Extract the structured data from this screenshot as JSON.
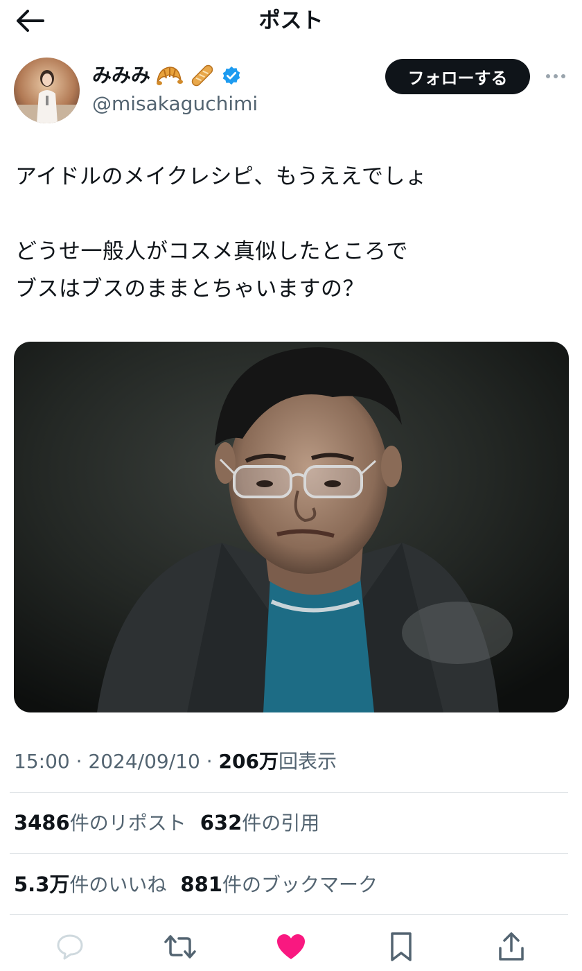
{
  "header": {
    "title": "ポスト",
    "back_icon": "arrow-left-icon"
  },
  "author": {
    "display_name": "みみみ",
    "name_emoji": [
      "croissant-icon",
      "baguette-icon"
    ],
    "verified_icon": "verified-badge-icon",
    "handle": "@misakaguchimi",
    "follow_label": "フォローする",
    "more_icon": "more-horizontal-icon"
  },
  "tweet": {
    "lines": [
      "アイドルのメイクレシピ、もうええでしょ",
      "どうせ一般人がコスメ真似したところで",
      "ブスはブスのままとちゃいますの？"
    ]
  },
  "meta": {
    "time": "15:00",
    "date": "2024/09/10",
    "views_number": "206万",
    "views_label": "回表示"
  },
  "stats": {
    "reposts_number": "3486",
    "reposts_label": "件のリポスト",
    "quotes_number": "632",
    "quotes_label": "件の引用",
    "likes_number": "5.3万",
    "likes_label": "件のいいね",
    "bookmarks_number": "881",
    "bookmarks_label": "件のブックマーク"
  },
  "actions": {
    "reply_icon": "reply-icon",
    "repost_icon": "repost-icon",
    "like_icon": "heart-filled-icon",
    "bookmark_icon": "bookmark-icon",
    "share_icon": "share-icon"
  },
  "colors": {
    "text": "#0f1419",
    "secondary": "#536471",
    "verified": "#1d9bf0",
    "like": "#f91880",
    "divider": "#e1e5e8"
  }
}
